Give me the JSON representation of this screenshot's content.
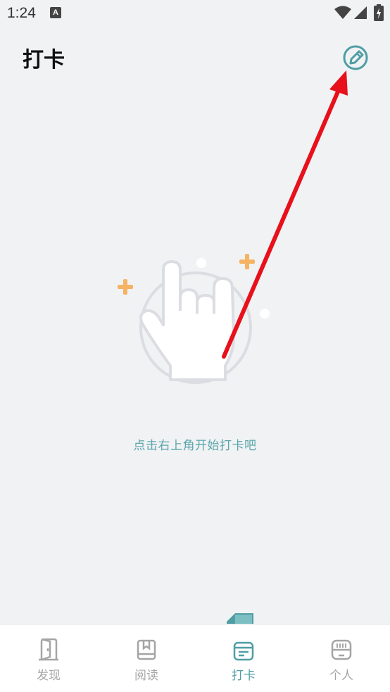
{
  "status_bar": {
    "time": "1:24",
    "app_icon_letter": "A",
    "icons": [
      "wifi-icon",
      "signal-icon",
      "battery-icon"
    ]
  },
  "header": {
    "title": "打卡",
    "action_icon": "edit-pencil-icon"
  },
  "empty_state": {
    "illustration": "pointing-hand-illustration",
    "hint": "点击右上角开始打卡吧"
  },
  "tab_bar": {
    "tabs": [
      {
        "label": "发现",
        "icon": "door-icon",
        "active": false
      },
      {
        "label": "阅读",
        "icon": "book-icon",
        "active": false
      },
      {
        "label": "打卡",
        "icon": "checkin-calendar-icon",
        "active": true
      },
      {
        "label": "个人",
        "icon": "profile-card-icon",
        "active": false
      }
    ]
  },
  "colors": {
    "accent": "#4f9ea4",
    "hint_text": "#5aa6ab",
    "inactive_tab": "#a5a5a5",
    "background": "#f1f2f4",
    "plus_marks": "#f5b363",
    "annotation_arrow": "#e8101a"
  }
}
